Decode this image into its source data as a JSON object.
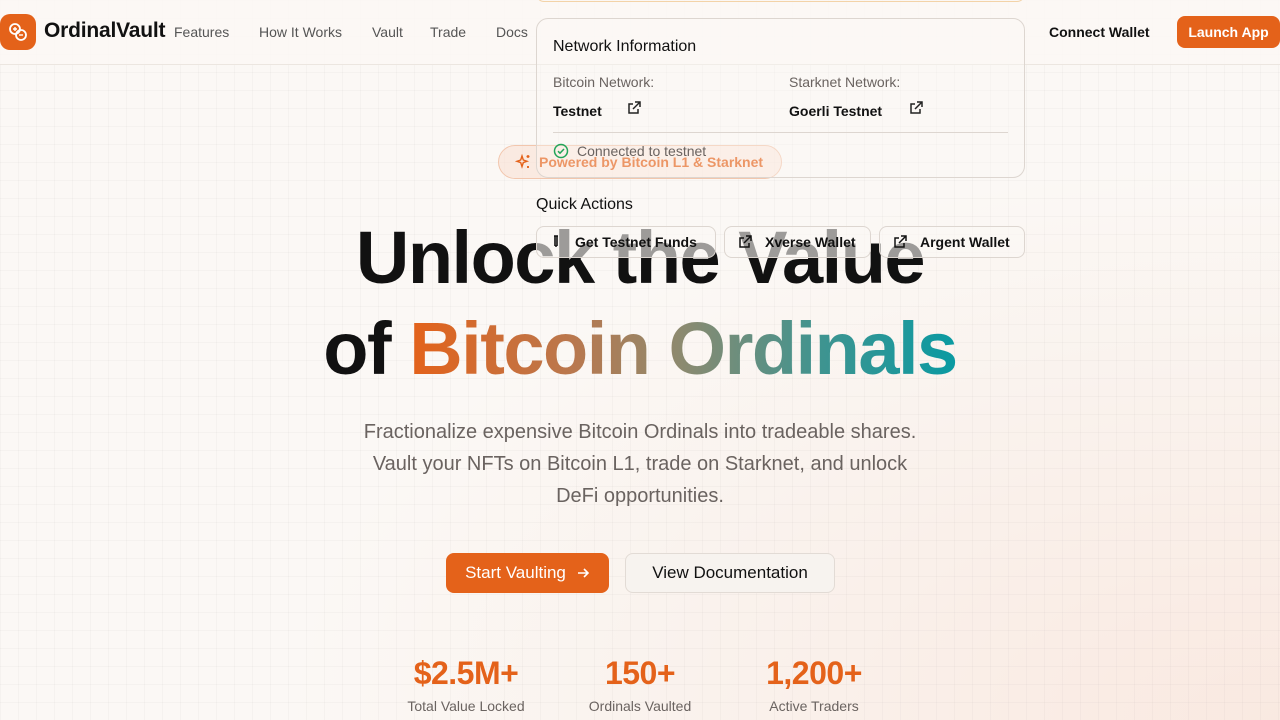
{
  "brand": {
    "name": "OrdinalVault",
    "accent": "#e4621a",
    "teal": "#0a9aa2"
  },
  "nav": {
    "links": [
      "Features",
      "How It Works",
      "Vault",
      "Trade",
      "Docs"
    ],
    "connect_label": "Connect Wallet",
    "launch_label": "Launch App"
  },
  "network_popup": {
    "title": "Network Information",
    "bitcoin_label": "Bitcoin Network:",
    "bitcoin_value": "Testnet",
    "starknet_label": "Starknet Network:",
    "starknet_value": "Goerli Testnet",
    "status": "Connected to testnet",
    "status_color": "#22a55a"
  },
  "quick_actions": {
    "title": "Quick Actions",
    "items": [
      "Get Testnet Funds",
      "Xverse Wallet",
      "Argent Wallet"
    ]
  },
  "hero": {
    "badge": "Powered by Bitcoin L1 & Starknet",
    "line1": "Unlock the Value",
    "line2_prefix": "of",
    "line2_highlight": "Bitcoin Ordinals",
    "subtitle_1": "Fractionalize expensive Bitcoin Ordinals into tradeable shares.",
    "subtitle_2": "Vault your NFTs on Bitcoin L1, trade on Starknet, and unlock",
    "subtitle_3": "DeFi opportunities.",
    "primary_button": "Start Vaulting",
    "secondary_button": "View Documentation"
  },
  "stats": [
    {
      "value": "$2.5M+",
      "label": "Total Value Locked"
    },
    {
      "value": "150+",
      "label": "Ordinals Vaulted"
    },
    {
      "value": "1,200+",
      "label": "Active Traders"
    }
  ]
}
